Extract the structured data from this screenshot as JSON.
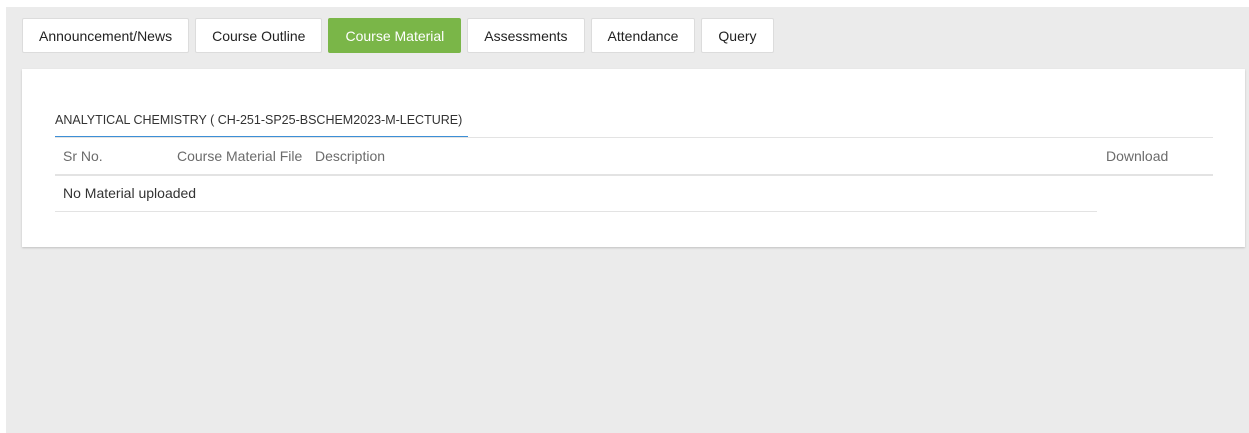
{
  "tabs": [
    {
      "label": "Announcement/News",
      "active": false
    },
    {
      "label": "Course Outline",
      "active": false
    },
    {
      "label": "Course Material",
      "active": true
    },
    {
      "label": "Assessments",
      "active": false
    },
    {
      "label": "Attendance",
      "active": false
    },
    {
      "label": "Query",
      "active": false
    }
  ],
  "course": {
    "title": "ANALYTICAL CHEMISTRY ( CH-251-SP25-BSCHEM2023-M-LECTURE)"
  },
  "table": {
    "headers": {
      "sr_no": "Sr No.",
      "file": "Course Material File",
      "description": "Description",
      "download": "Download"
    },
    "empty_message": "No Material uploaded"
  },
  "colors": {
    "active_tab": "#7ab648",
    "title_underline": "#3d8fd6",
    "background": "#ebebeb"
  }
}
